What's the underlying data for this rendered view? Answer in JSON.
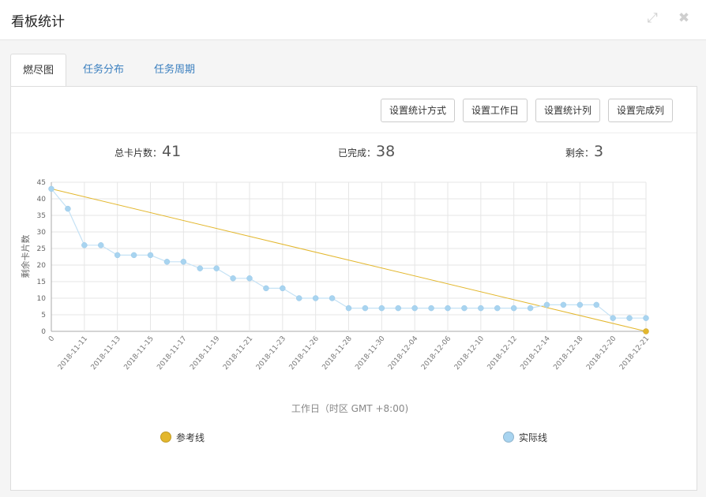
{
  "window": {
    "title": "看板统计",
    "expand_icon": "expand-icon",
    "close_icon": "close-icon"
  },
  "tabs": [
    {
      "label": "燃尽图",
      "active": true
    },
    {
      "label": "任务分布",
      "active": false
    },
    {
      "label": "任务周期",
      "active": false
    }
  ],
  "toolbar": {
    "buttons": [
      "设置统计方式",
      "设置工作日",
      "设置统计列",
      "设置完成列"
    ]
  },
  "stats": {
    "total_label": "总卡片数：",
    "total_value": "41",
    "done_label": "已完成：",
    "done_value": "38",
    "remaining_label": "剩余：",
    "remaining_value": "3"
  },
  "legend": {
    "reference": {
      "label": "参考线",
      "color": "#e3b72d"
    },
    "actual": {
      "label": "实际线",
      "color": "#a8d4f0"
    }
  },
  "chart_data": {
    "type": "line",
    "xlabel": "工作日（时区 GMT +8:00)",
    "ylabel": "剩余卡片数",
    "ylim": [
      0,
      45
    ],
    "yticks": [
      0,
      5,
      10,
      15,
      20,
      25,
      30,
      35,
      40,
      45
    ],
    "x_tick_labels": [
      "0",
      "2018-11-11",
      "2018-11-13",
      "2018-11-15",
      "2018-11-17",
      "2018-11-19",
      "2018-11-21",
      "2018-11-23",
      "2018-11-26",
      "2018-11-28",
      "2018-11-30",
      "2018-12-04",
      "2018-12-06",
      "2018-12-10",
      "2018-12-12",
      "2018-12-14",
      "2018-12-18",
      "2018-12-20",
      "2018-12-21"
    ],
    "grid": true,
    "legend_position": "bottom",
    "series": [
      {
        "name": "参考线",
        "color": "#e3b72d",
        "values": [
          43,
          0
        ]
      },
      {
        "name": "实际线",
        "color": "#a8d4f0",
        "values": [
          43,
          37,
          26,
          26,
          23,
          23,
          23,
          21,
          21,
          19,
          19,
          16,
          16,
          13,
          13,
          10,
          10,
          10,
          7,
          7,
          7,
          7,
          7,
          7,
          7,
          7,
          7,
          7,
          7,
          7,
          8,
          8,
          8,
          8,
          4,
          4,
          4
        ]
      }
    ]
  }
}
